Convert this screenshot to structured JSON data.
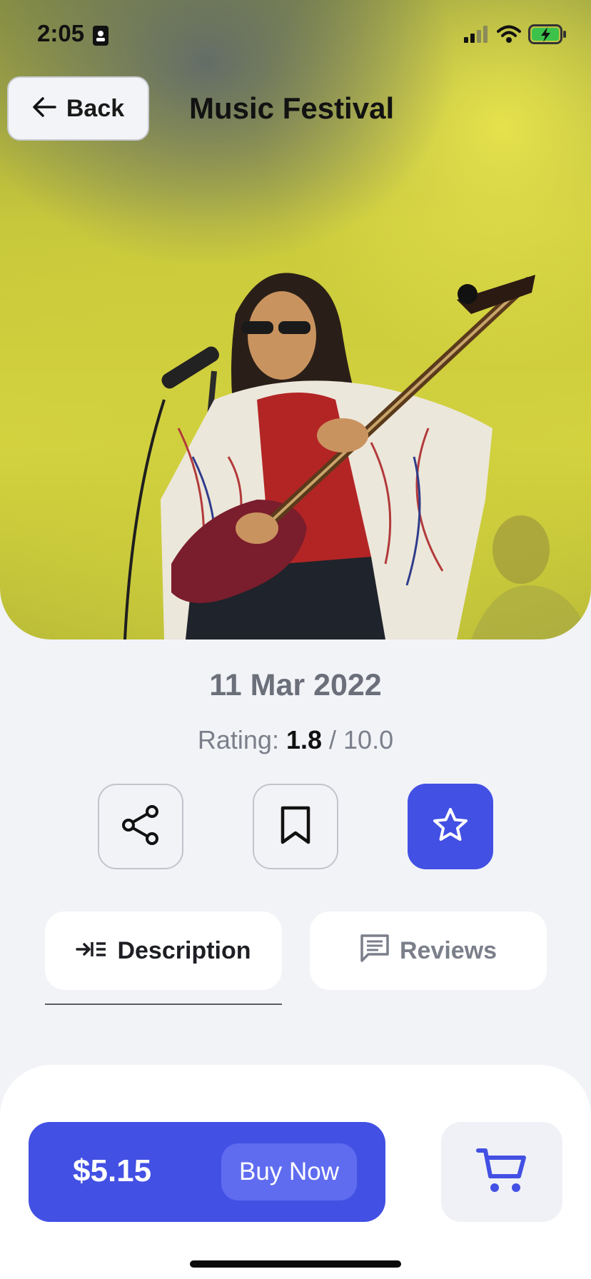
{
  "status_bar": {
    "time": "2:05",
    "icons": [
      "id-card-icon",
      "cellular-signal-icon",
      "wifi-icon",
      "battery-charging-icon"
    ]
  },
  "header": {
    "back_label": "Back",
    "title": "Music Festival"
  },
  "hero": {
    "image": "guitarist-performing-on-stage-photo"
  },
  "event": {
    "date": "11 Mar 2022",
    "rating_prefix": "Rating:",
    "rating_value": "1.8",
    "rating_suffix": "/ 10.0"
  },
  "actions": [
    {
      "name": "share",
      "icon": "share-icon"
    },
    {
      "name": "bookmark",
      "icon": "bookmark-icon"
    },
    {
      "name": "favorite",
      "icon": "star-icon"
    }
  ],
  "tabs": [
    {
      "label": "Description",
      "icon": "indent-list-icon",
      "active": true
    },
    {
      "label": "Reviews",
      "icon": "message-icon",
      "active": false
    }
  ],
  "purchase": {
    "price": "$5.15",
    "buy_label": "Buy Now",
    "cart_icon": "cart-icon"
  },
  "colors": {
    "accent": "#4350E4",
    "accent_light": "#5F6CF0",
    "background": "#F2F3F7",
    "muted_text": "#7B7F8A"
  }
}
